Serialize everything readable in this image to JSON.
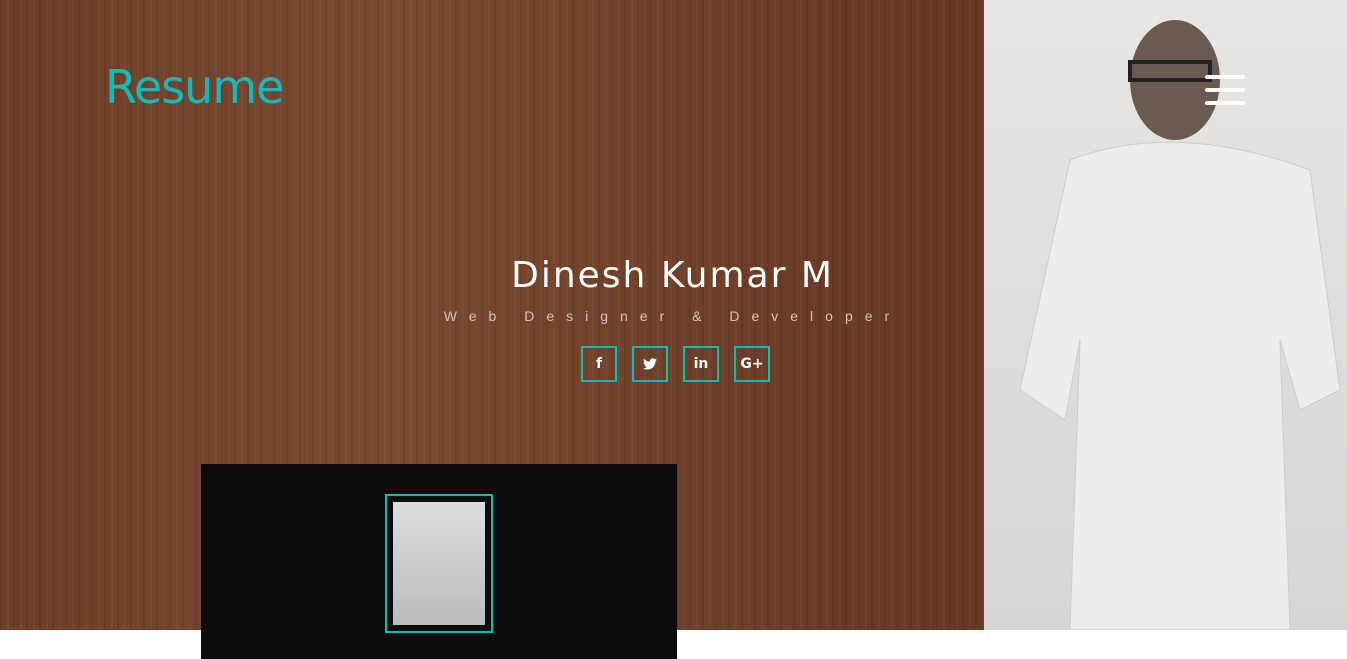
{
  "header": {
    "logo": "Resume"
  },
  "hero": {
    "name": "Dinesh Kumar M",
    "role": "Web Designer & Developer",
    "social": [
      {
        "icon": "facebook-icon",
        "label": "f"
      },
      {
        "icon": "twitter-icon",
        "label": "🐦"
      },
      {
        "icon": "linkedin-icon",
        "label": "in"
      },
      {
        "icon": "google-plus-icon",
        "label": "G+"
      }
    ]
  },
  "colors": {
    "accent": "#16b9b9",
    "card": "#0c0c0c"
  }
}
